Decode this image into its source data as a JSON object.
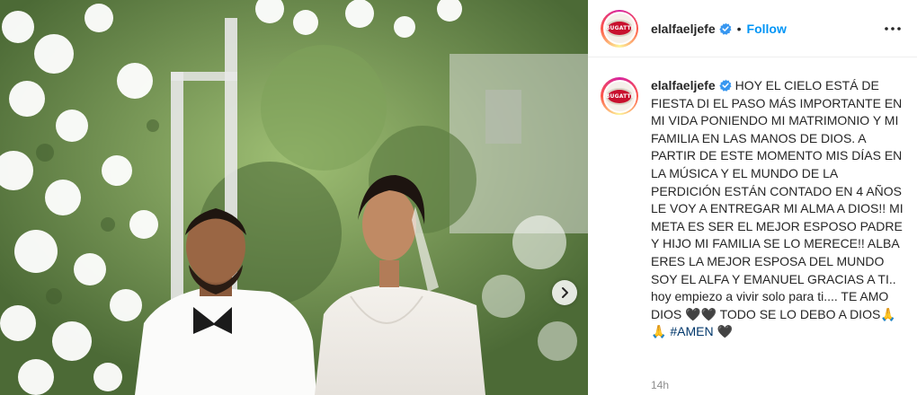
{
  "post": {
    "username": "elalfaeljefe",
    "verified": true,
    "dot": "•",
    "follow_label": "Follow",
    "avatar_badge_text": "BUGATTI",
    "caption_text": "HOY EL CIELO ESTÁ DE FIESTA DI EL PASO MÁS IMPORTANTE EN MI VIDA PONIENDO MI MATRIMONIO Y MI FAMILIA EN LAS MANOS DE DIOS. A PARTIR DE ESTE MOMENTO MIS DÍAS EN LA MÚSICA Y EL MUNDO DE LA PERDICIÓN ESTÁN CONTADO EN 4 AÑOS LE VOY A ENTREGAR MI ALMA A DIOS!! MI META ES SER EL MEJOR ESPOSO PADRE Y HIJO MI FAMILIA SE LO MERECE!! ALBA ERES LA MEJOR ESPOSA DEL MUNDO SOY EL ALFA Y EMANUEL GRACIAS A TI.. hoy empiezo a vivir solo para ti.... TE AMO DIOS 🖤🖤 TODO SE LO DEBO A DIOS🙏🙏",
    "hashtag": "#AMEN",
    "caption_end": " 🖤",
    "timestamp": "14h"
  },
  "icons": {
    "verified": "verified-badge-icon",
    "more": "more-options-icon",
    "next": "chevron-right-icon"
  },
  "colors": {
    "follow": "#0095f6",
    "verified": "#3897f0",
    "hashtag": "#00376b",
    "timestamp": "#8e8e8e"
  }
}
